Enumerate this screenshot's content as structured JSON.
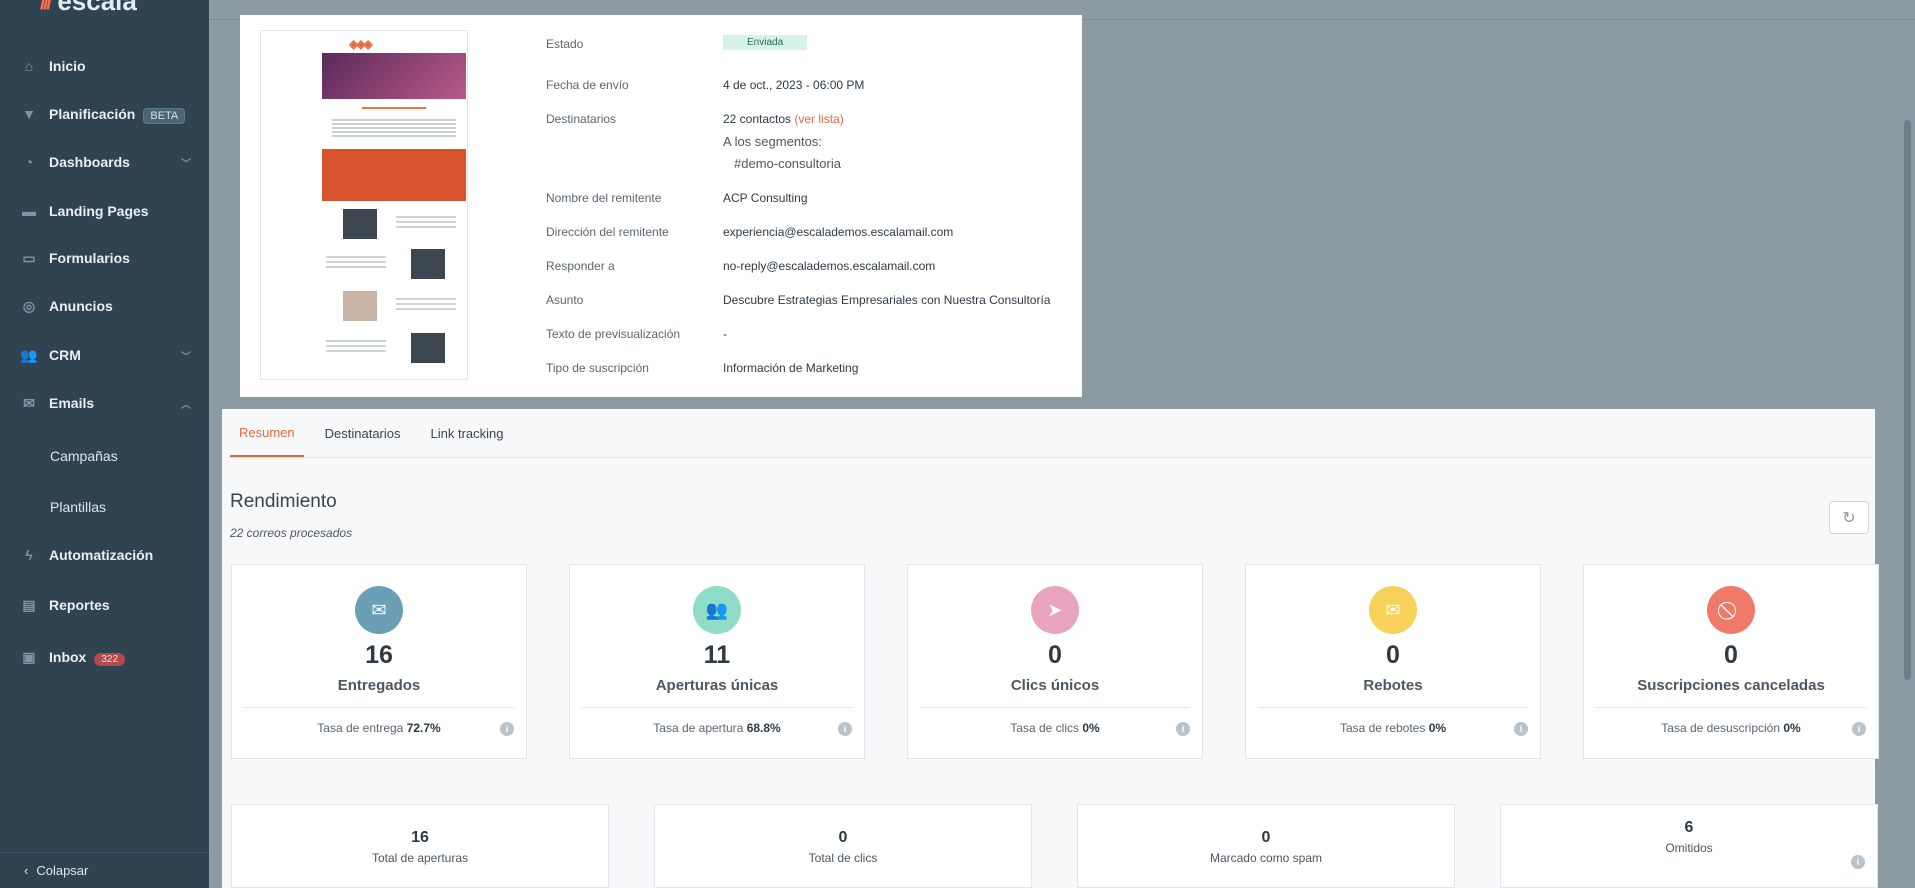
{
  "sidebar": {
    "logo": "escala",
    "items": [
      {
        "label": "Inicio",
        "icon": "home-icon"
      },
      {
        "label": "Planificación",
        "badge": "BETA",
        "icon": "funnel-icon"
      },
      {
        "label": "Dashboards",
        "icon": "pie-icon"
      },
      {
        "label": "Landing Pages",
        "icon": "page-icon"
      },
      {
        "label": "Formularios",
        "icon": "form-icon"
      },
      {
        "label": "Anuncios",
        "icon": "target-icon"
      },
      {
        "label": "CRM",
        "icon": "users-icon"
      },
      {
        "label": "Emails",
        "icon": "mail-icon"
      },
      {
        "label": "Campañas"
      },
      {
        "label": "Plantillas"
      },
      {
        "label": "Automatización",
        "icon": "bolt-icon"
      },
      {
        "label": "Reportes",
        "icon": "chart-icon"
      },
      {
        "label": "Inbox",
        "badge": "322",
        "icon": "inbox-icon"
      }
    ],
    "collapse": "Colapsar"
  },
  "detail": {
    "estado_label": "Estado",
    "estado_value": "Enviada",
    "fecha_label": "Fecha de envío",
    "fecha_value": "4 de oct., 2023 - 06:00 PM",
    "dest_label": "Destinatarios",
    "dest_value": "22 contactos",
    "dest_link": "(ver lista)",
    "segments_intro": "A los segmentos:",
    "segment": "#demo-consultoria",
    "remitente_label": "Nombre del remitente",
    "remitente_value": "ACP Consulting",
    "dir_label": "Dirección del remitente",
    "dir_value": "experiencia@escalademos.escalamail.com",
    "reply_label": "Responder a",
    "reply_value": "no-reply@escalademos.escalamail.com",
    "asunto_label": "Asunto",
    "asunto_value": "Descubre Estrategias Empresariales con Nuestra Consultoría",
    "preview_label": "Texto de previsualización",
    "preview_value": "-",
    "tipo_label": "Tipo de suscripción",
    "tipo_value": "Información de Marketing"
  },
  "tabs": [
    "Resumen",
    "Destinatarios",
    "Link tracking"
  ],
  "rendimiento": {
    "title": "Rendimiento",
    "subtitle": "22 correos procesados"
  },
  "stats": [
    {
      "value": "16",
      "label": "Entregados",
      "rate_label": "Tasa de entrega",
      "rate": "72.7%",
      "color": "#6a9fb5",
      "icon": "mail-check-icon"
    },
    {
      "value": "11",
      "label": "Aperturas únicas",
      "rate_label": "Tasa de apertura",
      "rate": "68.8%",
      "color": "#8fdcc8",
      "icon": "group-icon"
    },
    {
      "value": "0",
      "label": "Clics únicos",
      "rate_label": "Tasa de clics",
      "rate": "0%",
      "color": "#e8a4bf",
      "icon": "cursor-icon"
    },
    {
      "value": "0",
      "label": "Rebotes",
      "rate_label": "Tasa de rebotes",
      "rate": "0%",
      "color": "#f7d15a",
      "icon": "mail-bounce-icon"
    },
    {
      "value": "0",
      "label": "Suscripciones canceladas",
      "rate_label": "Tasa de desuscripción",
      "rate": "0%",
      "color": "#f07a6a",
      "icon": "ban-icon"
    }
  ],
  "stats2": [
    {
      "value": "16",
      "label": "Total de aperturas"
    },
    {
      "value": "0",
      "label": "Total de clics"
    },
    {
      "value": "0",
      "label": "Marcado como spam"
    },
    {
      "value": "6",
      "label": "Omitidos"
    }
  ]
}
